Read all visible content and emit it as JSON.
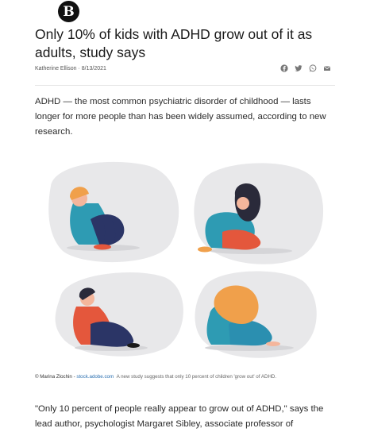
{
  "header": {
    "logo_letter": "B"
  },
  "article": {
    "title": "Only 10% of kids with ADHD grow out of it as adults, study says",
    "byline": "Katherine Ellison · 8/13/2021",
    "share_icons": [
      "facebook-icon",
      "twitter-icon",
      "whatsapp-icon",
      "email-icon"
    ],
    "lede": "ADHD — the most common psychiatric disorder of childhood — lasts longer for more people than has been widely assumed, according to new research.",
    "caption": {
      "credit": "© Marina Zlochin - ",
      "link": "stock.adobe.com",
      "text": "A new study suggests that only 10 percent of children 'grow out' of ADHD."
    },
    "body_start": "\"Only 10 percent of people really appear to grow out of ADHD,\" says the lead author, psychologist Margaret Sibley, associate professor of"
  },
  "colors": {
    "blob": "#e8e8ea",
    "teal": "#2e9bb3",
    "navy": "#2b3566",
    "coral": "#e4573c",
    "orange": "#f0a04b",
    "skin": "#f4b69c",
    "dark_hair": "#2a2a3a"
  }
}
